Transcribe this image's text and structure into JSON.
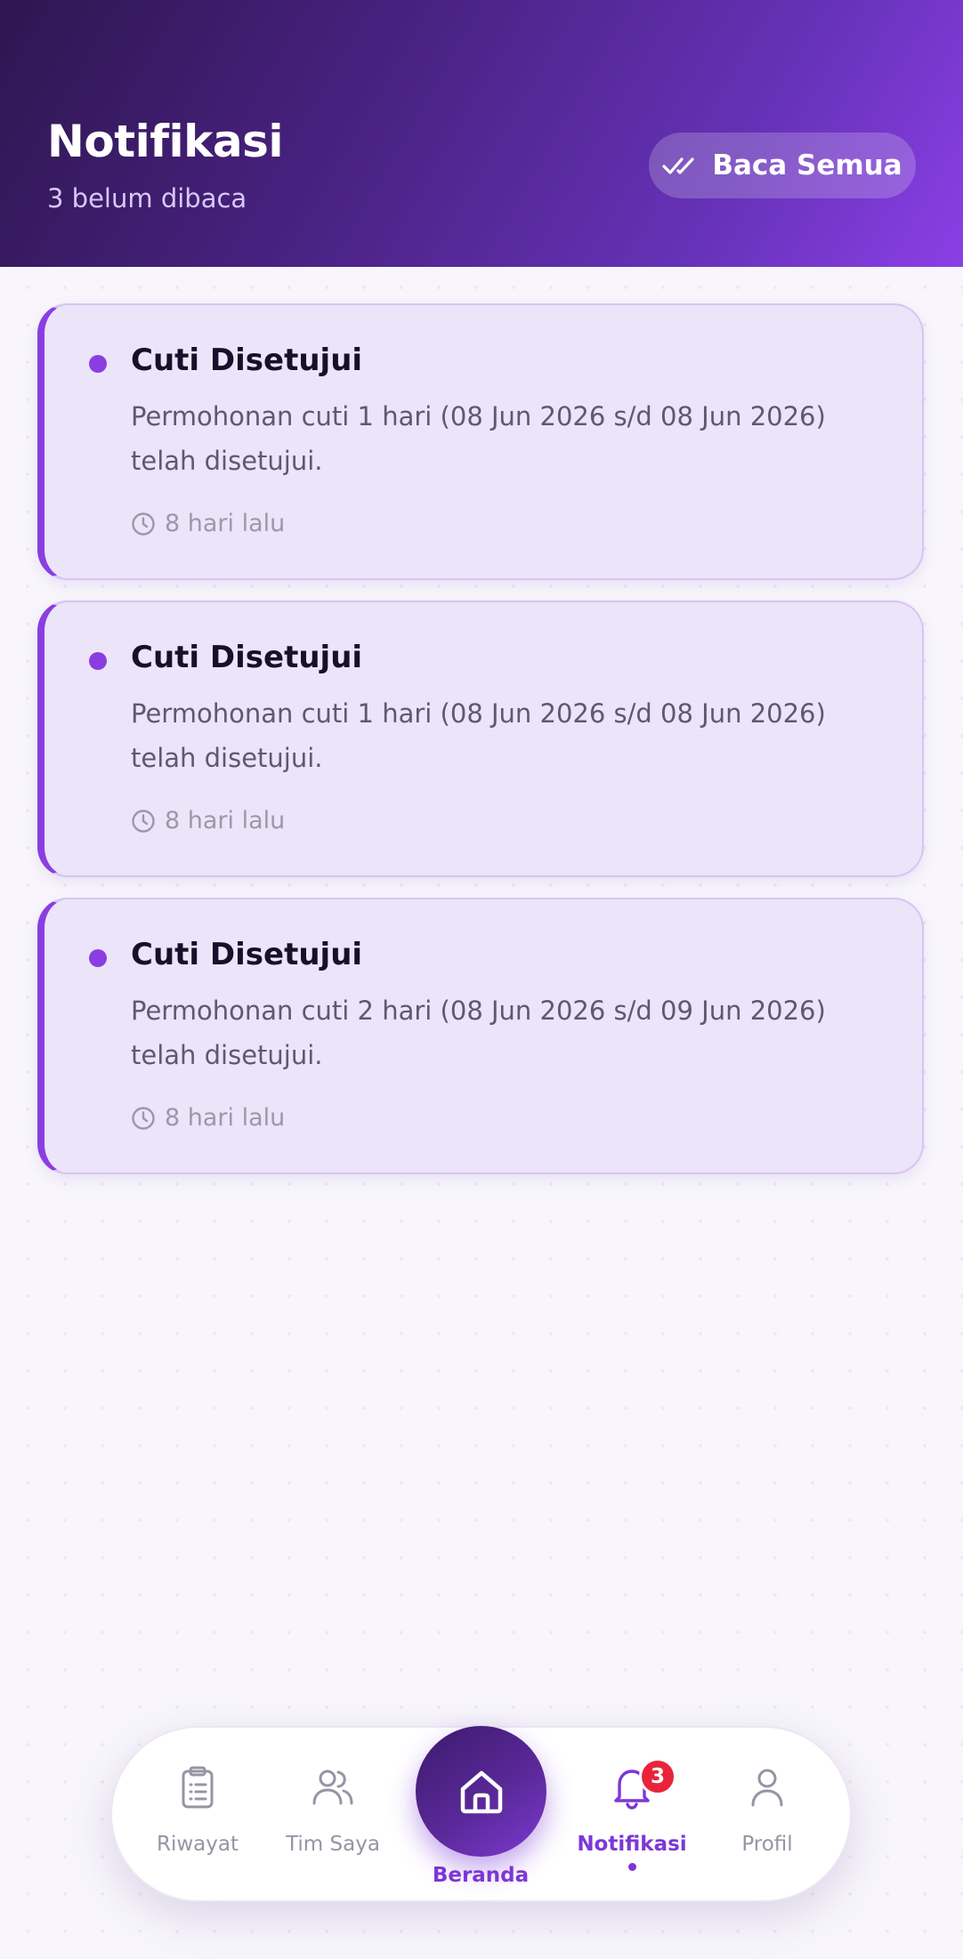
{
  "header": {
    "title": "Notifikasi",
    "subtitle": "3 belum dibaca",
    "read_all_label": "Baca Semua",
    "read_all_icon": "double-check-icon"
  },
  "notifications": [
    {
      "title": "Cuti Disetujui",
      "message": "Permohonan cuti 1 hari (08 Jun 2026 s/d 08 Jun 2026) telah disetujui.",
      "time": "8 hari lalu",
      "unread": true
    },
    {
      "title": "Cuti Disetujui",
      "message": "Permohonan cuti 1 hari (08 Jun 2026 s/d 08 Jun 2026) telah disetujui.",
      "time": "8 hari lalu",
      "unread": true
    },
    {
      "title": "Cuti Disetujui",
      "message": "Permohonan cuti 2 hari (08 Jun 2026 s/d 09 Jun 2026) telah disetujui.",
      "time": "8 hari lalu",
      "unread": true
    }
  ],
  "nav": {
    "items": [
      {
        "label": "Riwayat",
        "icon": "clipboard-icon"
      },
      {
        "label": "Tim Saya",
        "icon": "users-icon"
      },
      {
        "label": "Beranda",
        "icon": "home-icon"
      },
      {
        "label": "Notifikasi",
        "icon": "bell-icon",
        "badge": "3",
        "active": true
      },
      {
        "label": "Profil",
        "icon": "user-icon"
      }
    ]
  },
  "colors": {
    "accent": "#7c37d6",
    "header_dark": "#2e1650",
    "header_light": "#8b3fe6",
    "card_bg": "#ece4f8",
    "badge": "#e9243a"
  }
}
